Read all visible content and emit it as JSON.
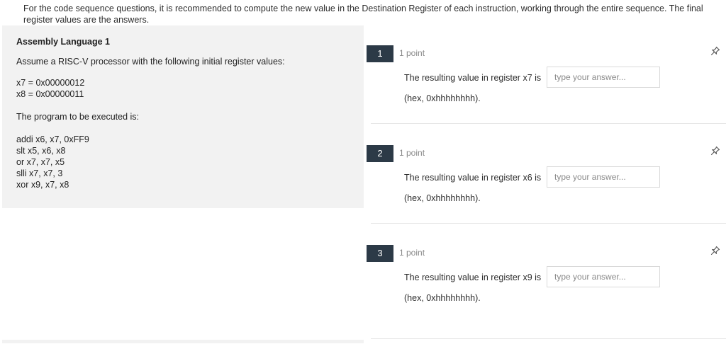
{
  "instructions": "For the code sequence questions, it is recommended to compute the new value in the Destination Register of each instruction, working through the entire sequence.  The final register values are the answers.",
  "stimulus": {
    "title": "Assembly Language 1",
    "intro": "Assume a RISC-V processor with the following initial register values:",
    "registers": [
      "x7 = 0x00000012",
      "x8 = 0x00000011"
    ],
    "program_intro": "The program to be executed is:",
    "program": [
      "addi x6, x7, 0xFF9",
      "slt x5, x6, x8",
      "or x7, x7, x5",
      "slli x7, x7, 3",
      "xor x9, x7, x8"
    ]
  },
  "questions": [
    {
      "number": "1",
      "points": "1 point",
      "prompt": "The resulting value in register x7 is",
      "placeholder": "type your answer...",
      "hint": "(hex, 0xhhhhhhhh)."
    },
    {
      "number": "2",
      "points": "1 point",
      "prompt": "The resulting value in register x6 is",
      "placeholder": "type your answer...",
      "hint": "(hex, 0xhhhhhhhh)."
    },
    {
      "number": "3",
      "points": "1 point",
      "prompt": "The resulting value in register x9 is",
      "placeholder": "type your answer...",
      "hint": "(hex, 0xhhhhhhhh)."
    }
  ],
  "icons": {
    "pin": "pin-icon"
  },
  "colors": {
    "question_number_bg": "#2c3a47",
    "stimulus_bg": "#f2f2f2",
    "muted_text": "#8a8a8a"
  }
}
